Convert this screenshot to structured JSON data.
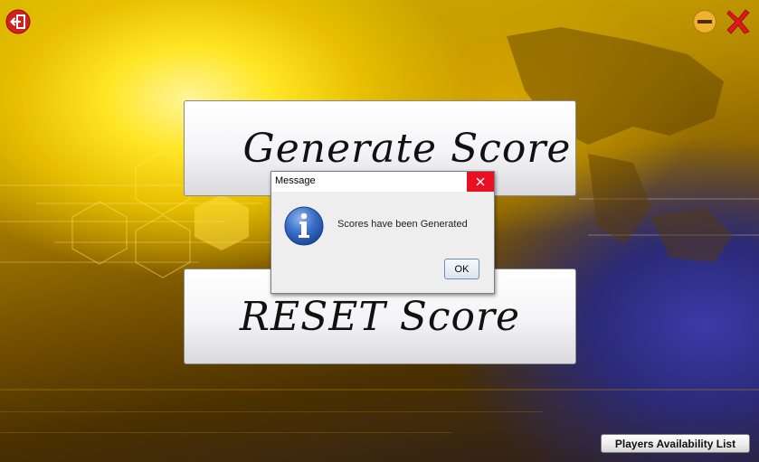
{
  "toolbar": {
    "exit_icon": "exit-door-icon",
    "minimize_icon": "minimize-circle-icon",
    "close_icon": "red-x-close-icon"
  },
  "main": {
    "generate_label": "Generate Score",
    "reset_label": "RESET Score"
  },
  "dialog": {
    "title": "Message",
    "message": "Scores have been Generated",
    "ok_label": "OK",
    "icon": "information-icon"
  },
  "footer": {
    "players_label": "Players Availability List"
  },
  "colors": {
    "dialog_close_bg": "#e81123",
    "minimize_icon": "#f0b030",
    "close_icon": "#e01818",
    "exit_icon": "#d21f1f"
  }
}
